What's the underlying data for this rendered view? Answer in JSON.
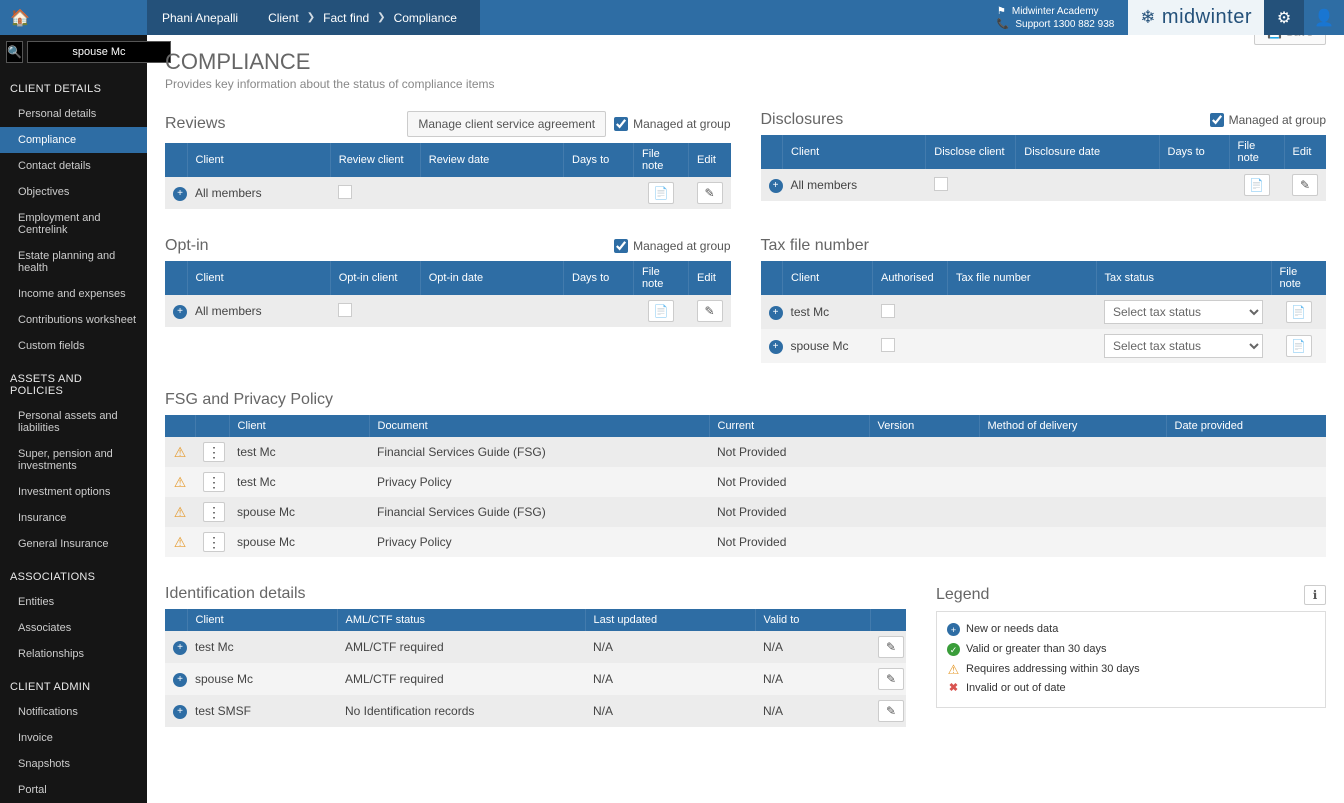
{
  "topbar": {
    "user": "Phani Anepalli",
    "breadcrumb": [
      "Client",
      "Fact find",
      "Compliance"
    ],
    "academy": "Midwinter Academy",
    "support": "Support 1300 882 938",
    "brand": "midwinter"
  },
  "search_value": "spouse Mc",
  "sidebar": {
    "groups": [
      {
        "title": "CLIENT DETAILS",
        "items": [
          "Personal details",
          "Compliance",
          "Contact details",
          "Objectives",
          "Employment and Centrelink",
          "Estate planning and health",
          "Income and expenses",
          "Contributions worksheet",
          "Custom fields"
        ],
        "active": "Compliance"
      },
      {
        "title": "ASSETS AND POLICIES",
        "items": [
          "Personal assets and liabilities",
          "Super, pension and investments",
          "Investment options",
          "Insurance",
          "General Insurance"
        ]
      },
      {
        "title": "ASSOCIATIONS",
        "items": [
          "Entities",
          "Associates",
          "Relationships"
        ]
      },
      {
        "title": "CLIENT ADMIN",
        "items": [
          "Notifications",
          "Invoice",
          "Snapshots",
          "Portal"
        ]
      }
    ]
  },
  "page": {
    "title": "COMPLIANCE",
    "subtitle": "Provides key information about the status of compliance items",
    "save": "Save"
  },
  "reviews": {
    "title": "Reviews",
    "manage_btn": "Manage client service agreement",
    "managed_label": "Managed at group",
    "headers": [
      "",
      "Client",
      "Review client",
      "Review date",
      "Days to",
      "File note",
      "Edit"
    ],
    "row_client": "All members"
  },
  "disclosures": {
    "title": "Disclosures",
    "managed_label": "Managed at group",
    "headers": [
      "",
      "Client",
      "Disclose client",
      "Disclosure date",
      "Days to",
      "File note",
      "Edit"
    ],
    "row_client": "All members"
  },
  "optin": {
    "title": "Opt-in",
    "managed_label": "Managed at group",
    "headers": [
      "",
      "Client",
      "Opt-in client",
      "Opt-in date",
      "Days to",
      "File note",
      "Edit"
    ],
    "row_client": "All members"
  },
  "tfn": {
    "title": "Tax file number",
    "headers": [
      "",
      "Client",
      "Authorised",
      "Tax file number",
      "Tax status",
      "File note"
    ],
    "rows": [
      {
        "client": "test Mc"
      },
      {
        "client": "spouse Mc"
      }
    ],
    "select_placeholder": "Select tax status"
  },
  "fsg": {
    "title": "FSG and Privacy Policy",
    "headers": [
      "",
      "",
      "Client",
      "Document",
      "Current",
      "Version",
      "Method of delivery",
      "Date provided"
    ],
    "rows": [
      {
        "client": "test Mc",
        "doc": "Financial Services Guide (FSG)",
        "current": "Not Provided"
      },
      {
        "client": "test Mc",
        "doc": "Privacy Policy",
        "current": "Not Provided"
      },
      {
        "client": "spouse Mc",
        "doc": "Financial Services Guide (FSG)",
        "current": "Not Provided"
      },
      {
        "client": "spouse Mc",
        "doc": "Privacy Policy",
        "current": "Not Provided"
      }
    ]
  },
  "ident": {
    "title": "Identification details",
    "headers": [
      "",
      "Client",
      "AML/CTF status",
      "Last updated",
      "Valid to",
      ""
    ],
    "rows": [
      {
        "client": "test Mc",
        "status": "AML/CTF required",
        "updated": "N/A",
        "valid": "N/A"
      },
      {
        "client": "spouse Mc",
        "status": "AML/CTF required",
        "updated": "N/A",
        "valid": "N/A"
      },
      {
        "client": "test SMSF",
        "status": "No Identification records",
        "updated": "N/A",
        "valid": "N/A"
      }
    ]
  },
  "legend": {
    "title": "Legend",
    "items": [
      "New or needs data",
      "Valid or greater than 30 days",
      "Requires addressing within 30 days",
      "Invalid or out of date"
    ]
  }
}
